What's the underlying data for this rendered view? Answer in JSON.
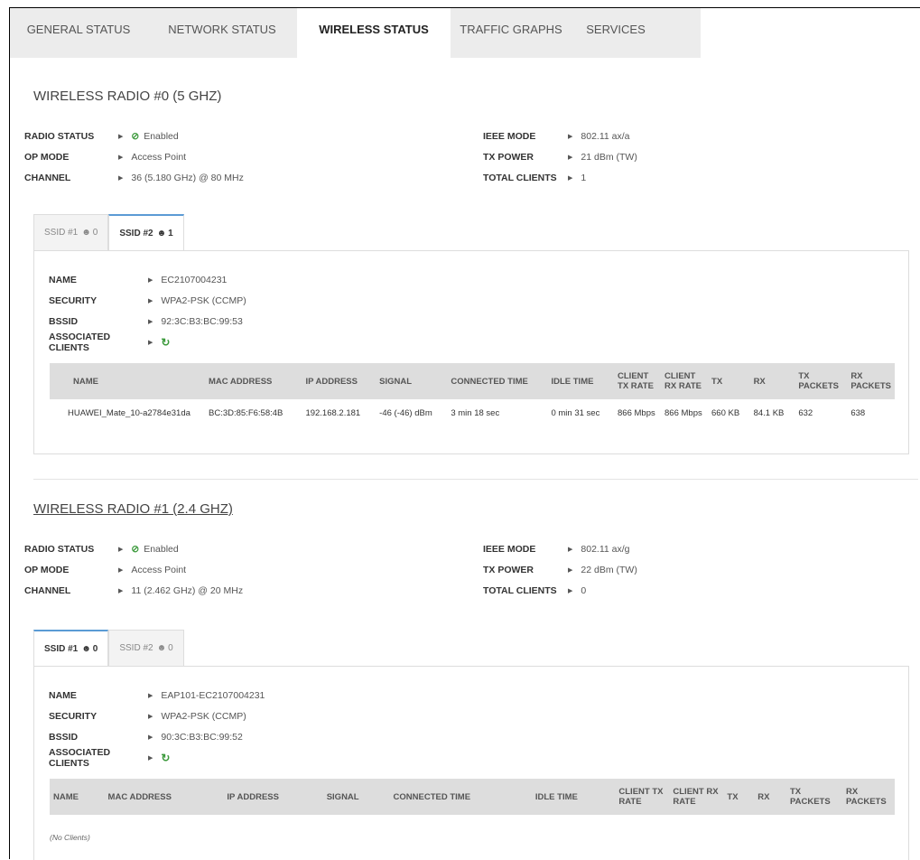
{
  "nav": {
    "tabs": [
      "GENERAL STATUS",
      "NETWORK STATUS",
      "WIRELESS STATUS",
      "TRAFFIC GRAPHS",
      "SERVICES"
    ],
    "active": "WIRELESS STATUS"
  },
  "radio0": {
    "title": "WIRELESS RADIO #0 (5 GHZ)",
    "labels": {
      "radio_status": "RADIO STATUS",
      "op_mode": "OP MODE",
      "channel": "CHANNEL",
      "ieee_mode": "IEEE MODE",
      "tx_power": "TX POWER",
      "total_clients": "TOTAL CLIENTS"
    },
    "radio_status": "Enabled",
    "op_mode": "Access Point",
    "channel": "36 (5.180 GHz) @ 80 MHz",
    "ieee_mode": "802.11 ax/a",
    "tx_power": "21 dBm (TW)",
    "total_clients": "1",
    "ssid_tabs": [
      {
        "label": "SSID #1",
        "count": "0"
      },
      {
        "label": "SSID #2",
        "count": "1"
      }
    ],
    "ssid": {
      "labels": {
        "name": "NAME",
        "security": "SECURITY",
        "bssid": "BSSID",
        "assoc": "ASSOCIATED CLIENTS"
      },
      "name": "EC2107004231",
      "security": "WPA2-PSK (CCMP)",
      "bssid": "92:3C:B3:BC:99:53"
    },
    "columns": [
      "NAME",
      "MAC ADDRESS",
      "IP ADDRESS",
      "SIGNAL",
      "CONNECTED TIME",
      "IDLE TIME",
      "CLIENT TX RATE",
      "CLIENT RX RATE",
      "TX",
      "RX",
      "TX PACKETS",
      "RX PACKETS"
    ],
    "clients": [
      {
        "name": "HUAWEI_Mate_10-a2784e31da",
        "mac": "BC:3D:85:F6:58:4B",
        "ip": "192.168.2.181",
        "signal": "-46 (-46) dBm",
        "connected": "3 min 18 sec",
        "idle": "0 min 31 sec",
        "tx_rate": "866 Mbps",
        "rx_rate": "866 Mbps",
        "tx": "660 KB",
        "rx": "84.1 KB",
        "tx_packets": "632",
        "rx_packets": "638"
      }
    ]
  },
  "radio1": {
    "title": "WIRELESS RADIO #1 (2.4 GHZ)",
    "radio_status": "Enabled",
    "op_mode": "Access Point",
    "channel": "11 (2.462 GHz) @ 20 MHz",
    "ieee_mode": "802.11 ax/g",
    "tx_power": "22 dBm (TW)",
    "total_clients": "0",
    "ssid_tabs": [
      {
        "label": "SSID #1",
        "count": "0"
      },
      {
        "label": "SSID #2",
        "count": "0"
      }
    ],
    "ssid": {
      "name": "EAP101-EC2107004231",
      "security": "WPA2-PSK (CCMP)",
      "bssid": "90:3C:B3:BC:99:52"
    },
    "no_clients": "(No Clients)"
  }
}
